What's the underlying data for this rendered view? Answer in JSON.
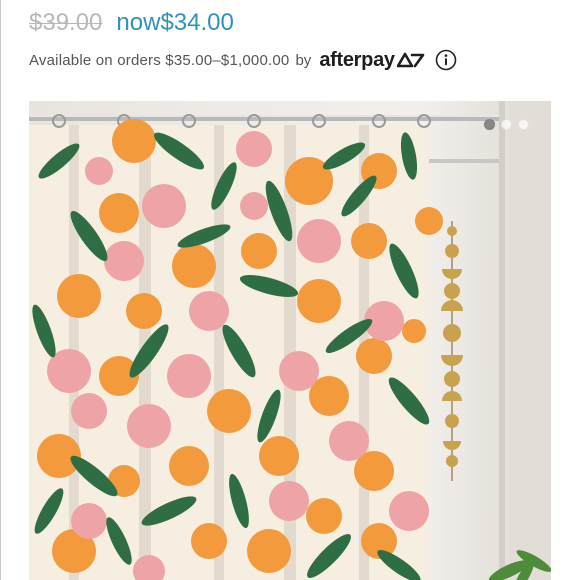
{
  "product": {
    "price_original": "$39.00",
    "price_now_label": "now",
    "price_now_value": "$34.00"
  },
  "payment": {
    "availability_text": "Available on orders $35.00–$1,000.00",
    "by_text": "by",
    "provider_name": "afterpay",
    "info_icon": "info-circle-icon"
  },
  "gallery": {
    "image_subject": "peach-print-shower-curtain-photo",
    "total_images": 3,
    "current_index": 1
  },
  "colors": {
    "sale_price": "#2f93b8",
    "strike_price": "#b8b8b8",
    "peach_orange": "#f29a3c",
    "peach_pink": "#eea3a6",
    "leaf_green": "#2f6e45",
    "curtain_cream": "#f7eee2"
  }
}
